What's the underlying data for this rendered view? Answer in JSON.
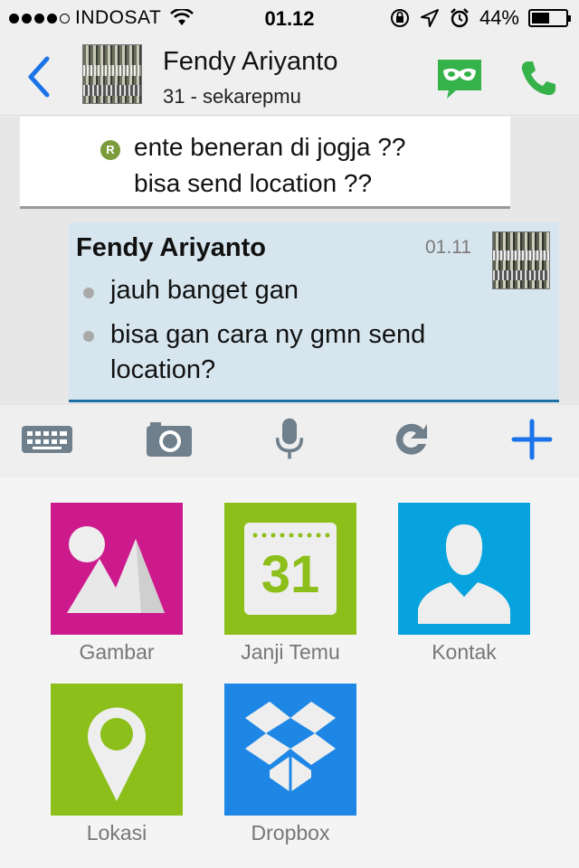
{
  "status_bar": {
    "carrier": "INDOSAT",
    "time": "01.12",
    "battery": "44%",
    "signal_bars_filled": 4,
    "signal_bars_total": 5
  },
  "header": {
    "contact_name": "Fendy Ariyanto",
    "contact_status": "31 - sekarepmu",
    "accent_color": "#1a73e8",
    "green_color": "#35b24a"
  },
  "messages": {
    "outgoing": {
      "read_badge": "R",
      "lines": [
        "ente beneran di jogja ??",
        "bisa send location ??"
      ]
    },
    "incoming": {
      "sender": "Fendy Ariyanto",
      "time": "01.11",
      "items": [
        {
          "lines": [
            "jauh banget gan"
          ]
        },
        {
          "lines": [
            "bisa gan cara ny gmn send",
            "location?"
          ]
        }
      ]
    }
  },
  "toolbar": {
    "icons": [
      "keyboard-icon",
      "camera-icon",
      "microphone-icon",
      "refresh-icon",
      "plus-icon"
    ]
  },
  "attachments": [
    {
      "label": "Gambar",
      "icon": "picture-icon",
      "color": "#cc1a8d"
    },
    {
      "label": "Janji Temu",
      "icon": "calendar-icon",
      "color": "#8cbf1a",
      "calendar_day": "31"
    },
    {
      "label": "Kontak",
      "icon": "contact-icon",
      "color": "#06a3de"
    },
    {
      "label": "Lokasi",
      "icon": "location-icon",
      "color": "#8cbf1a"
    },
    {
      "label": "Dropbox",
      "icon": "dropbox-icon",
      "color": "#1e87e5"
    }
  ]
}
